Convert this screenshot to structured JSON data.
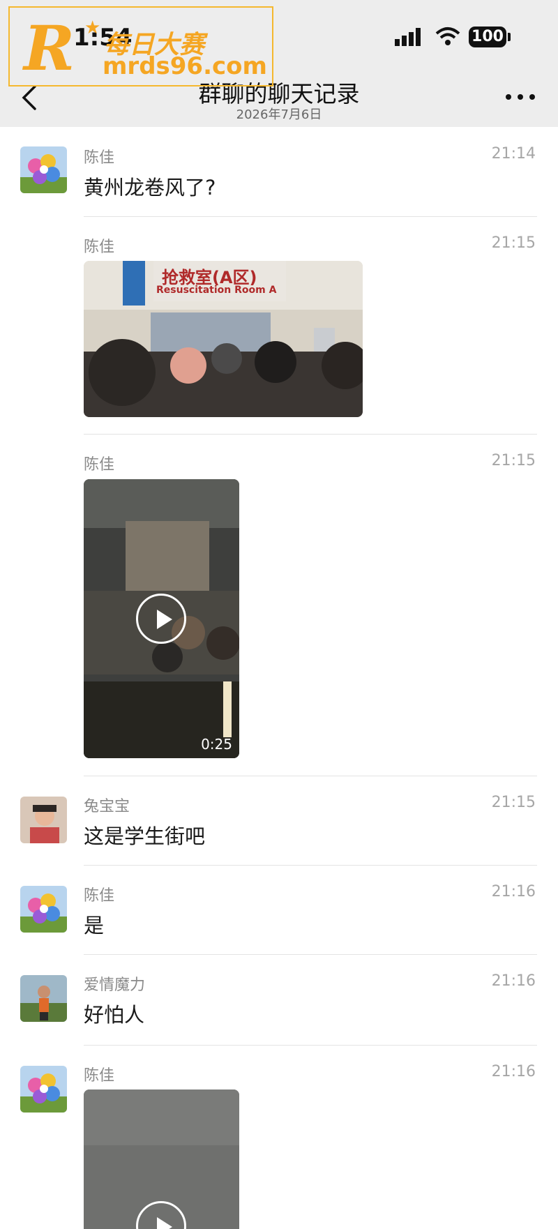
{
  "status_bar": {
    "time": "1:54"
  },
  "battery_level": "100",
  "nav": {
    "title": "群聊的聊天记录",
    "subtitle": "2026年7月6日"
  },
  "watermark": {
    "cn": "每日大赛",
    "url": "mrds96.com",
    "logo_letter": "R"
  },
  "messages": [
    {
      "sender": "陈佳",
      "time": "21:14",
      "text": "黄州龙卷风了?"
    },
    {
      "sender": "陈佳",
      "time": "21:15",
      "image_caption": "抢救室(A区)",
      "image_caption_en": "Resuscitation Room A"
    },
    {
      "sender": "陈佳",
      "time": "21:15",
      "video_duration": "0:25"
    },
    {
      "sender": "兔宝宝",
      "time": "21:15",
      "text": "这是学生街吧"
    },
    {
      "sender": "陈佳",
      "time": "21:16",
      "text": "是"
    },
    {
      "sender": "爱情魔力",
      "time": "21:16",
      "text": "好怕人"
    },
    {
      "sender": "陈佳",
      "time": "21:16"
    }
  ]
}
